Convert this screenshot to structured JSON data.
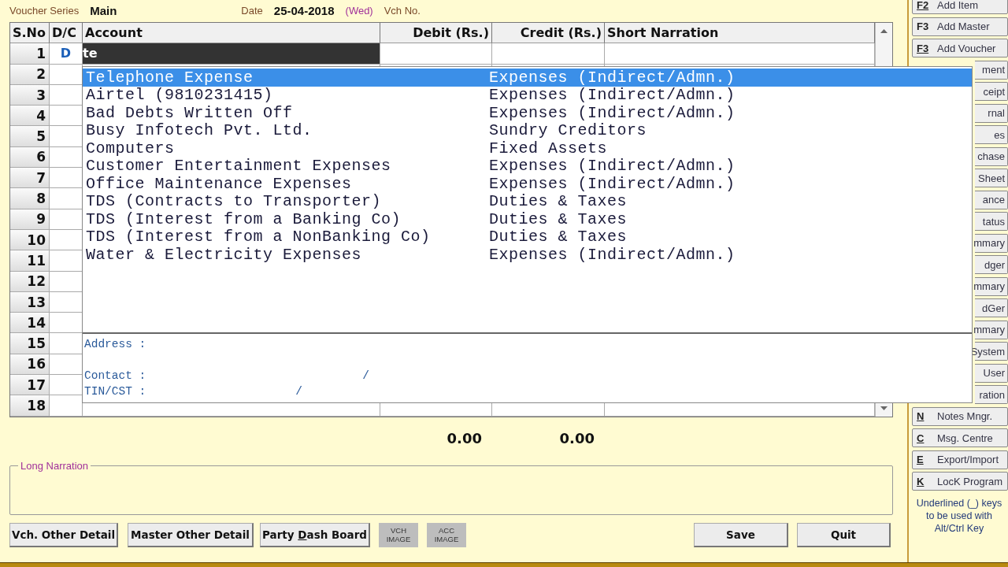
{
  "header": {
    "series_label": "Voucher Series",
    "series": "Main",
    "date_label": "Date",
    "date": "25-04-2018",
    "day": "(Wed)",
    "vch_no_label": "Vch No."
  },
  "grid": {
    "columns": [
      "S.No",
      "D/C",
      "Account",
      "Debit (Rs.)",
      "Credit (Rs.)",
      "Short Narration"
    ],
    "current_entry": {
      "dc": "D",
      "account": "te"
    },
    "rows": [
      {
        "sno": "1"
      },
      {
        "sno": "2"
      },
      {
        "sno": "3"
      },
      {
        "sno": "4"
      },
      {
        "sno": "5"
      },
      {
        "sno": "6"
      },
      {
        "sno": "7"
      },
      {
        "sno": "8"
      },
      {
        "sno": "9"
      },
      {
        "sno": "10"
      },
      {
        "sno": "11"
      },
      {
        "sno": "12"
      },
      {
        "sno": "13"
      },
      {
        "sno": "14"
      },
      {
        "sno": "15"
      },
      {
        "sno": "16"
      },
      {
        "sno": "17"
      },
      {
        "sno": "18"
      }
    ]
  },
  "dropdown": {
    "items": [
      {
        "name": "Telephone Expense",
        "group": "Expenses (Indirect/Admn.)",
        "selected": true
      },
      {
        "name": "Airtel (9810231415)",
        "group": "Expenses (Indirect/Admn.)",
        "selected": false
      },
      {
        "name": "Bad Debts Written Off",
        "group": "Expenses (Indirect/Admn.)",
        "selected": false
      },
      {
        "name": "Busy Infotech Pvt. Ltd.",
        "group": "Sundry Creditors",
        "selected": false
      },
      {
        "name": "Computers",
        "group": "Fixed Assets",
        "selected": false
      },
      {
        "name": "Customer Entertainment Expenses",
        "group": "Expenses (Indirect/Admn.)",
        "selected": false
      },
      {
        "name": "Office Maintenance Expenses",
        "group": "Expenses (Indirect/Admn.)",
        "selected": false
      },
      {
        "name": "TDS (Contracts to Transporter)",
        "group": "Duties & Taxes",
        "selected": false
      },
      {
        "name": "TDS (Interest from a Banking Co)",
        "group": "Duties & Taxes",
        "selected": false
      },
      {
        "name": "TDS (Interest from a NonBanking Co)",
        "group": "Duties & Taxes",
        "selected": false
      },
      {
        "name": "Water & Electricity Expenses",
        "group": "Expenses (Indirect/Admn.)",
        "selected": false
      }
    ],
    "details": [
      {
        "label": "Address :"
      },
      {
        "label": "Contact :",
        "separator": "/"
      },
      {
        "label": "TIN/CST :",
        "separator": "/"
      }
    ]
  },
  "totals": {
    "debit": "0.00",
    "credit": "0.00"
  },
  "long_narration": {
    "legend": "Long Narration"
  },
  "buttons": [
    {
      "kind": "text",
      "label": "Vch. Other Detail"
    },
    {
      "kind": "text",
      "label": "Master Other Detail"
    },
    {
      "kind": "hotkey",
      "before": "Party ",
      "hotkey": "D",
      "after": "ash Board"
    },
    {
      "kind": "image",
      "label": "VCH IMAGE"
    },
    {
      "kind": "image",
      "label": "ACC IMAGE"
    },
    {
      "kind": "text",
      "label": "Save"
    },
    {
      "kind": "text",
      "label": "Quit"
    }
  ],
  "side_buttons": [
    {
      "key": "F2",
      "label": "Add Item",
      "underlined": true
    },
    {
      "key": "F3",
      "label": "Add Master",
      "underlined": false
    },
    {
      "key": "F3",
      "label": "Add Voucher",
      "underlined": true
    },
    {
      "label": "ment"
    },
    {
      "label": "ceipt"
    },
    {
      "label": "rnal"
    },
    {
      "label": "es"
    },
    {
      "label": "chase"
    },
    {
      "label": "Sheet"
    },
    {
      "label": "ance"
    },
    {
      "label": "tatus"
    },
    {
      "label": "mmary"
    },
    {
      "label": "dger"
    },
    {
      "label": "mmary"
    },
    {
      "label": "dGer"
    },
    {
      "label": "mmary"
    },
    {
      "label": "System"
    },
    {
      "label": "User"
    },
    {
      "label": "ration"
    },
    {
      "key": "N",
      "label": "Notes Mngr.",
      "underlined": true
    },
    {
      "key": "C",
      "label": "Msg. Centre",
      "underlined": true
    },
    {
      "key": "E",
      "label": "Export/Import",
      "underlined": true
    },
    {
      "key": "K",
      "label": "LocK Program",
      "underlined": true
    }
  ],
  "help_text": "Underlined (_) keys to be used with Alt/Ctrl Key"
}
